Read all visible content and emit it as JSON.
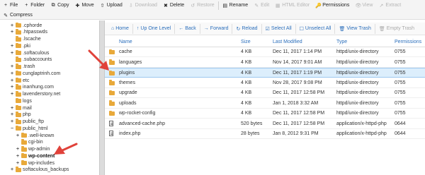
{
  "toolbar": {
    "row1": [
      {
        "icon": "+",
        "label": "File",
        "disabled": false
      },
      {
        "icon": "+",
        "label": "Folder",
        "disabled": false
      },
      {
        "icon": "⧉",
        "label": "Copy",
        "disabled": false
      },
      {
        "icon": "✚",
        "label": "Move",
        "disabled": false
      },
      {
        "icon": "⇧",
        "label": "Upload",
        "disabled": false
      },
      {
        "icon": "⇩",
        "label": "Download",
        "disabled": true
      },
      {
        "icon": "✖",
        "label": "Delete",
        "disabled": false
      },
      {
        "icon": "↺",
        "label": "Restore",
        "disabled": true
      },
      {
        "icon": "▤",
        "label": "Rename",
        "disabled": false
      },
      {
        "icon": "✎",
        "label": "Edit",
        "disabled": true
      },
      {
        "icon": "▦",
        "label": "HTML Editor",
        "disabled": true
      },
      {
        "icon": "🔑",
        "label": "Permissions",
        "disabled": false
      },
      {
        "icon": "👁",
        "label": "View",
        "disabled": true
      },
      {
        "icon": "↗",
        "label": "Extract",
        "disabled": true
      }
    ],
    "row2": [
      {
        "icon": "✎",
        "label": "Compress",
        "disabled": false
      }
    ]
  },
  "tree": {
    "items": [
      {
        "label": ".cphorde",
        "expander": "+",
        "depth": 1
      },
      {
        "label": ".htpasswds",
        "expander": "+",
        "depth": 1
      },
      {
        "label": ".lscache",
        "expander": "",
        "depth": 1
      },
      {
        "label": ".pki",
        "expander": "+",
        "depth": 1
      },
      {
        "label": ".softaculous",
        "expander": "+",
        "depth": 1
      },
      {
        "label": ".subaccounts",
        "expander": "",
        "depth": 1
      },
      {
        "label": ".trash",
        "expander": "+",
        "depth": 1
      },
      {
        "label": "cunglaptrinh.com",
        "expander": "+",
        "depth": 1
      },
      {
        "label": "etc",
        "expander": "+",
        "depth": 1
      },
      {
        "label": "inanhung.com",
        "expander": "+",
        "depth": 1
      },
      {
        "label": "lavenderstory.net",
        "expander": "+",
        "depth": 1
      },
      {
        "label": "logs",
        "expander": "",
        "depth": 1
      },
      {
        "label": "mail",
        "expander": "+",
        "depth": 1
      },
      {
        "label": "php",
        "expander": "+",
        "depth": 1
      },
      {
        "label": "public_ftp",
        "expander": "+",
        "depth": 1
      },
      {
        "label": "public_html",
        "expander": "−",
        "depth": 1
      },
      {
        "label": ".well-known",
        "expander": "+",
        "depth": 2
      },
      {
        "label": "cgi-bin",
        "expander": "",
        "depth": 2
      },
      {
        "label": "wp-admin",
        "expander": "+",
        "depth": 2
      },
      {
        "label": "wp-content",
        "expander": "+",
        "depth": 2,
        "bold": true
      },
      {
        "label": "wp-includes",
        "expander": "+",
        "depth": 2
      },
      {
        "label": "softaculous_backups",
        "expander": "+",
        "depth": 1
      }
    ]
  },
  "nav": [
    {
      "icon": "⌂",
      "label": "Home",
      "disabled": false
    },
    {
      "icon": "↑",
      "label": "Up One Level",
      "disabled": false
    },
    {
      "icon": "←",
      "label": "Back",
      "disabled": false
    },
    {
      "icon": "→",
      "label": "Forward",
      "disabled": false
    },
    {
      "icon": "↻",
      "label": "Reload",
      "disabled": false
    },
    {
      "icon": "☑",
      "label": "Select All",
      "disabled": false
    },
    {
      "icon": "☐",
      "label": "Unselect All",
      "disabled": false
    },
    {
      "icon": "🗑",
      "label": "View Trash",
      "disabled": false
    },
    {
      "icon": "🗑",
      "label": "Empty Trash",
      "disabled": true
    }
  ],
  "table": {
    "headers": {
      "name": "Name",
      "size": "Size",
      "modified": "Last Modified",
      "type": "Type",
      "permissions": "Permissions"
    },
    "rows": [
      {
        "icon": "folder",
        "name": "cache",
        "size": "4 KB",
        "modified": "Dec 11, 2017 1:14 PM",
        "type": "httpd/unix-directory",
        "permissions": "0755",
        "selected": false
      },
      {
        "icon": "folder",
        "name": "languages",
        "size": "4 KB",
        "modified": "Nov 14, 2017 9:01 AM",
        "type": "httpd/unix-directory",
        "permissions": "0755",
        "selected": false
      },
      {
        "icon": "folder",
        "name": "plugins",
        "size": "4 KB",
        "modified": "Dec 11, 2017 1:19 PM",
        "type": "httpd/unix-directory",
        "permissions": "0755",
        "selected": true
      },
      {
        "icon": "folder",
        "name": "themes",
        "size": "4 KB",
        "modified": "Nov 28, 2017 9:08 PM",
        "type": "httpd/unix-directory",
        "permissions": "0755",
        "selected": false
      },
      {
        "icon": "folder",
        "name": "upgrade",
        "size": "4 KB",
        "modified": "Dec 11, 2017 12:58 PM",
        "type": "httpd/unix-directory",
        "permissions": "0755",
        "selected": false
      },
      {
        "icon": "folder",
        "name": "uploads",
        "size": "4 KB",
        "modified": "Jan 1, 2018 3:32 AM",
        "type": "httpd/unix-directory",
        "permissions": "0755",
        "selected": false
      },
      {
        "icon": "folder",
        "name": "wp-rocket-config",
        "size": "4 KB",
        "modified": "Dec 11, 2017 12:58 PM",
        "type": "httpd/unix-directory",
        "permissions": "0755",
        "selected": false
      },
      {
        "icon": "file",
        "name": "advanced-cache.php",
        "size": "520 bytes",
        "modified": "Dec 11, 2017 12:58 PM",
        "type": "application/x-httpd-php",
        "permissions": "0644",
        "selected": false
      },
      {
        "icon": "file",
        "name": "index.php",
        "size": "28 bytes",
        "modified": "Jan 8, 2012 9:31 PM",
        "type": "application/x-httpd-php",
        "permissions": "0644",
        "selected": false
      }
    ]
  },
  "annotations": {
    "arrow_color": "#e0423a"
  }
}
